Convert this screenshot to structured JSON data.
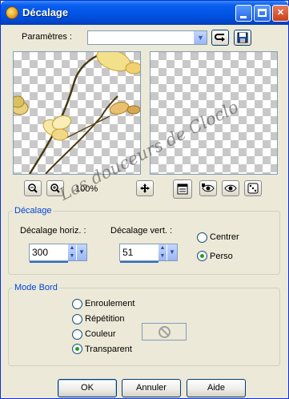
{
  "window": {
    "title": "Décalage",
    "minimize_glyph": "",
    "close_glyph": "✕"
  },
  "presets": {
    "label": "Paramètres :",
    "value": ""
  },
  "preview": {
    "zoom_level": "100%"
  },
  "offset": {
    "group_title": "Décalage",
    "horiz_label": "Décalage horiz. :",
    "horiz_value": "300",
    "vert_label": "Décalage vert. :",
    "vert_value": "51",
    "options": [
      "Centrer",
      "Perso"
    ],
    "selected": "Perso"
  },
  "edge_mode": {
    "group_title": "Mode Bord",
    "options": [
      "Enroulement",
      "Répétition",
      "Couleur",
      "Transparent"
    ],
    "selected": "Transparent"
  },
  "buttons": {
    "ok": "OK",
    "cancel": "Annuler",
    "help": "Aide"
  },
  "watermark_text": "Les douceurs de Cloclo",
  "colors": {
    "titlebar": "#0055e5",
    "dialog_bg": "#ece9d8",
    "group_title": "#0046d5",
    "radio_dot": "#21a121",
    "flower": "#f3e08a"
  }
}
